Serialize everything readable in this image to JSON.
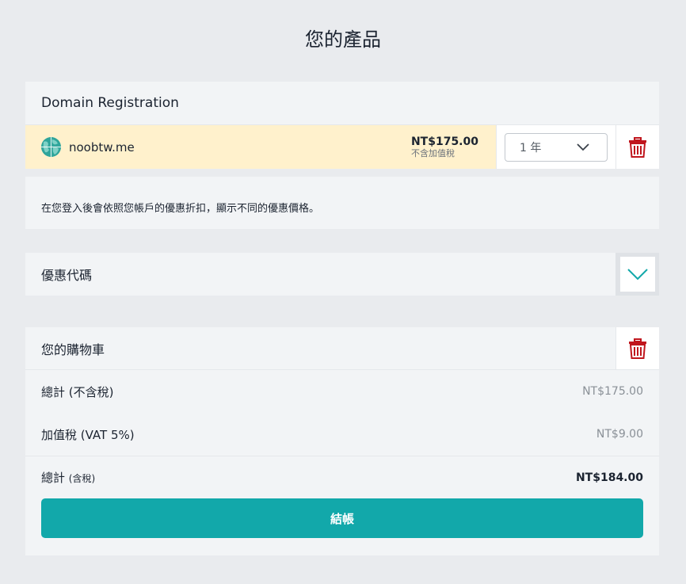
{
  "page": {
    "title": "您的產品"
  },
  "product": {
    "header": "Domain Registration",
    "domain": "noobtw.me",
    "price": "NT$175.00",
    "price_note": "不含加值稅",
    "period": "1 年",
    "info": "在您登入後會依照您帳戶的優惠折扣，顯示不同的優惠價格。"
  },
  "coupon": {
    "label": "優惠代碼"
  },
  "cart": {
    "title": "您的購物車",
    "subtotal_label": "總計 (不含稅)",
    "subtotal_value": "NT$175.00",
    "vat_label": "加值稅 (VAT 5%)",
    "vat_value": "NT$9.00",
    "total_label": "總計",
    "total_label_small": "(含稅)",
    "total_value": "NT$184.00",
    "checkout_label": "結帳"
  },
  "colors": {
    "accent": "#12a8aa",
    "trash": "#c0161d",
    "highlight": "#fff1cc"
  },
  "icons": {
    "domain": "globe-icon",
    "remove": "trash-icon",
    "dropdown": "chevron-down-icon"
  }
}
